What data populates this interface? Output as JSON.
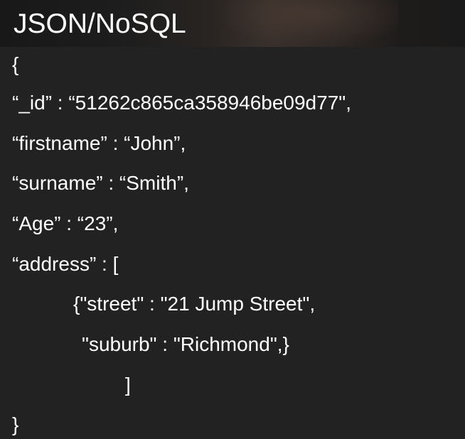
{
  "slide": {
    "title": "JSON/NoSQL",
    "lines": [
      "{",
      "“_id” : “51262c865ca358946be09d77\",",
      "“firstname” : “John”,",
      "“surname” : “Smith”,",
      "“Age” : “23”,",
      "“address” : [",
      "{\"street\" : \"21 Jump Street\",",
      "\"suburb\" : \"Richmond\",}",
      "]",
      "}"
    ]
  }
}
